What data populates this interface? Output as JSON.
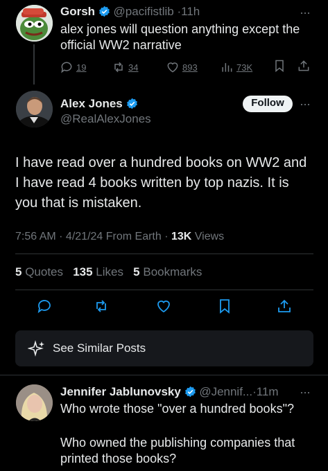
{
  "reply_parent": {
    "name": "Gorsh",
    "handle": "@pacifistlib",
    "sep": "·",
    "time": "11h",
    "text": "alex jones will question anything except the official WW2 narrative",
    "replies": "19",
    "reposts": "34",
    "likes": "893",
    "views": "73K"
  },
  "main": {
    "name": "Alex Jones",
    "handle": "@RealAlexJones",
    "follow_label": "Follow",
    "text": "I have read over a hundred books on WW2 and I have read 4 books written by top nazis. It is you that is mistaken.",
    "meta": "7:56 AM · 4/21/24 From Earth · ",
    "views_count": "13K",
    "views_label": " Views",
    "quotes_count": "5",
    "quotes_label": "Quotes",
    "likes_count": "135",
    "likes_label": "Likes",
    "bookmarks_count": "5",
    "bookmarks_label": "Bookmarks",
    "similar_label": "See Similar Posts"
  },
  "reply": {
    "name": "Jennifer Jablunovsky",
    "handle": "@Jennif...",
    "sep": "·",
    "time": "11m",
    "line1": "Who wrote those \"over a hundred books\"?",
    "line2": "Who owned the publishing companies that printed those books?"
  },
  "colors": {
    "background": "#000000",
    "text": "#e7e9ea",
    "muted": "#71767b",
    "verified": "#1d9bf0",
    "divider": "#2f3336"
  }
}
